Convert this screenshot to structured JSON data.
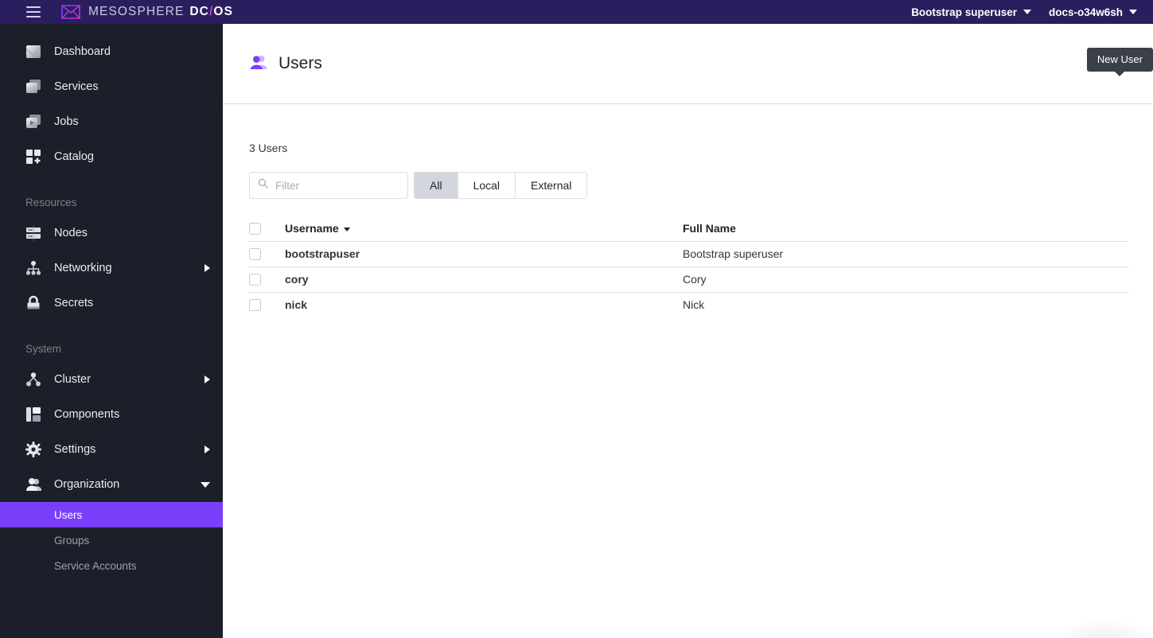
{
  "topbar": {
    "menu_icon": "hamburger-icon",
    "logo_icon": "mesosphere-logo-icon",
    "brand_meso": "MESOSPHERE",
    "brand_dc": "DC",
    "brand_slash": "/",
    "brand_os": "OS",
    "user_menu": "Bootstrap superuser",
    "cluster_menu": "docs-o34w6sh"
  },
  "sidebar": {
    "primary": [
      {
        "label": "Dashboard",
        "icon": "dashboard-icon"
      },
      {
        "label": "Services",
        "icon": "services-icon"
      },
      {
        "label": "Jobs",
        "icon": "jobs-icon"
      },
      {
        "label": "Catalog",
        "icon": "catalog-icon"
      }
    ],
    "resources_header": "Resources",
    "resources": [
      {
        "label": "Nodes",
        "icon": "nodes-icon",
        "expandable": false
      },
      {
        "label": "Networking",
        "icon": "networking-icon",
        "expandable": true
      },
      {
        "label": "Secrets",
        "icon": "secrets-icon",
        "expandable": false
      }
    ],
    "system_header": "System",
    "system": [
      {
        "label": "Cluster",
        "icon": "cluster-icon",
        "expandable": true
      },
      {
        "label": "Components",
        "icon": "components-icon",
        "expandable": false
      },
      {
        "label": "Settings",
        "icon": "settings-gear-icon",
        "expandable": true
      },
      {
        "label": "Organization",
        "icon": "organization-icon",
        "expandable": true,
        "expanded": true
      }
    ],
    "organization_children": [
      {
        "label": "Users",
        "active": true
      },
      {
        "label": "Groups",
        "active": false
      },
      {
        "label": "Service Accounts",
        "active": false
      }
    ],
    "active_color": "#7b3ffc"
  },
  "page": {
    "title": "Users",
    "title_icon": "users-people-icon",
    "new_user_button_icon": "plus-icon",
    "new_user_tooltip": "New User",
    "accent_color": "#7b3ffc"
  },
  "toolbar": {
    "count_text": "3 Users",
    "filter_placeholder": "Filter",
    "filter_value": "",
    "filter_icon": "search-icon",
    "tabs": [
      {
        "label": "All",
        "active": true
      },
      {
        "label": "Local",
        "active": false
      },
      {
        "label": "External",
        "active": false
      }
    ]
  },
  "table": {
    "columns": [
      {
        "key": "username",
        "label": "Username",
        "sorted": true,
        "sort_icon": "caret-down-icon"
      },
      {
        "key": "fullname",
        "label": "Full Name",
        "sorted": false
      }
    ],
    "select_all_checkbox": "unchecked",
    "rows": [
      {
        "checkbox": "unchecked",
        "username": "bootstrapuser",
        "fullname": "Bootstrap superuser"
      },
      {
        "checkbox": "unchecked",
        "username": "cory",
        "fullname": "Cory"
      },
      {
        "checkbox": "unchecked",
        "username": "nick",
        "fullname": "Nick"
      }
    ]
  }
}
